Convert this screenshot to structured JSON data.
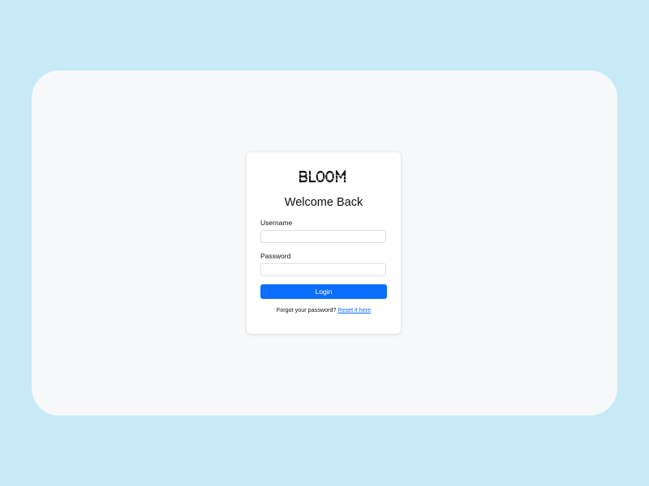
{
  "brand": {
    "logo_text": "BLOOM"
  },
  "login": {
    "title": "Welcome Back",
    "username_label": "Username",
    "username_value": "",
    "password_label": "Password",
    "password_value": "",
    "button_label": "Login",
    "forgot_text": "Forgot your password?",
    "reset_link": "Reset it here"
  },
  "colors": {
    "background": "#c8eaf7",
    "window": "#f7f8fa",
    "primary": "#0b6efd",
    "link": "#0b6efd"
  }
}
